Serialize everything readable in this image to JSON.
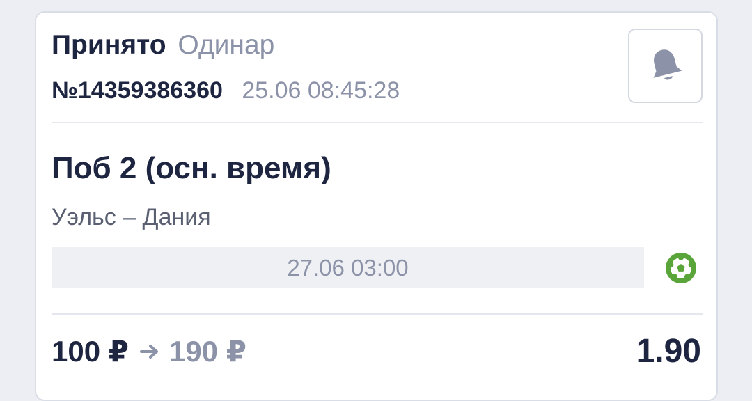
{
  "bet": {
    "status": "Принято",
    "type": "Одинар",
    "number": "№14359386360",
    "placed_at": "25.06 08:45:28"
  },
  "selection": {
    "outcome": "Поб 2 (осн. время)",
    "match": "Уэльс – Дания",
    "event_time": "27.06 03:00",
    "sport_icon": "football-icon"
  },
  "summary": {
    "stake": "100 ₽",
    "payout": "190 ₽",
    "odds": "1.90"
  },
  "colors": {
    "primary_text": "#1d2540",
    "secondary_text": "#8c93a8",
    "sport_icon": "#5aa53a"
  }
}
